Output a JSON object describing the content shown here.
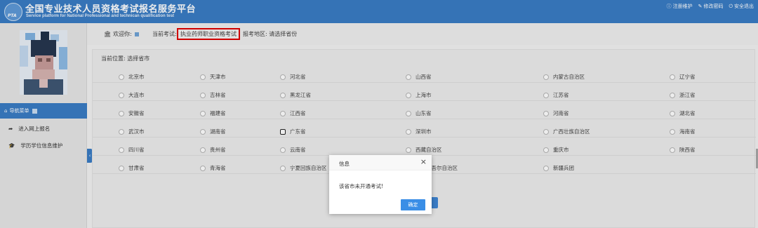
{
  "header": {
    "title": "全国专业技术人员资格考试报名服务平台",
    "subtitle": "Service platform for National Professional and technican qualification test",
    "logo_text": "PTA",
    "links": [
      {
        "label": "注册维护",
        "icon": "info-icon"
      },
      {
        "label": "修改密码",
        "icon": "edit-icon"
      },
      {
        "label": "安全退出",
        "icon": "power-icon"
      }
    ]
  },
  "sidebar": {
    "nav_header": "导航菜单",
    "items": [
      {
        "label": "进入网上报名",
        "icon": "share-arrow-icon"
      },
      {
        "label": "学历学位信息维护",
        "icon": "graduation-cap-icon"
      }
    ]
  },
  "infobar": {
    "welcome": "欢迎你:",
    "exam_label": "当前考试:",
    "exam_value": "执业药师职业资格考试",
    "region_label": "报考地区: 请选择省份"
  },
  "content": {
    "breadcrumb": "当前位置: 选择省市",
    "regions": [
      [
        "北京市",
        "天津市",
        "河北省",
        "山西省",
        "内蒙古自治区",
        "辽宁省"
      ],
      [
        "大连市",
        "吉林省",
        "黑龙江省",
        "上海市",
        "江苏省",
        "浙江省"
      ],
      [
        "安徽省",
        "福建省",
        "江西省",
        "山东省",
        "河南省",
        "湖北省"
      ],
      [
        "武汉市",
        "湖南省",
        "广东省",
        "深圳市",
        "广西壮族自治区",
        "海南省"
      ],
      [
        "四川省",
        "贵州省",
        "云南省",
        "西藏自治区",
        "重庆市",
        "陕西省"
      ],
      [
        "甘肃省",
        "青海省",
        "宁夏回族自治区",
        "新疆维吾尔自治区",
        "新疆兵团",
        ""
      ]
    ],
    "focused_region": "广东省"
  },
  "dialog": {
    "title": "信息",
    "close": "×",
    "message": "该省市未开通考试!",
    "ok_label": "确定"
  },
  "colors": {
    "brand_blue": "#3a7cc4",
    "highlight_red": "#e00000",
    "button_blue": "#3a8ee6"
  }
}
